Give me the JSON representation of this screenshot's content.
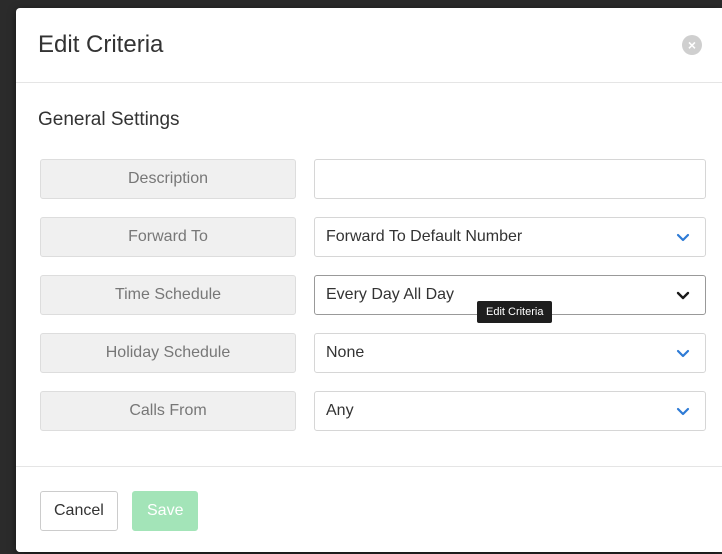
{
  "modal": {
    "title": "Edit Criteria",
    "close_glyph": "×"
  },
  "section": {
    "title": "General Settings"
  },
  "fields": [
    {
      "label": "Description",
      "value": "",
      "type": "text"
    },
    {
      "label": "Forward To",
      "value": "Forward To Default Number",
      "type": "select",
      "chevron_color": "#2e7bd6"
    },
    {
      "label": "Time Schedule",
      "value": "Every Day All Day",
      "type": "select",
      "chevron_color": "#1a1a1a"
    },
    {
      "label": "Holiday Schedule",
      "value": "None",
      "type": "select",
      "chevron_color": "#2e7bd6"
    },
    {
      "label": "Calls From",
      "value": "Any",
      "type": "select",
      "chevron_color": "#2e7bd6"
    }
  ],
  "tooltip": {
    "text": "Edit Criteria"
  },
  "footer": {
    "cancel_label": "Cancel",
    "save_label": "Save"
  },
  "colors": {
    "save_disabled": "#a3e4b8",
    "chevron_accent": "#2e7bd6"
  },
  "icons": {
    "close": "close-circle-icon",
    "dropdown": "chevron-down-icon"
  }
}
